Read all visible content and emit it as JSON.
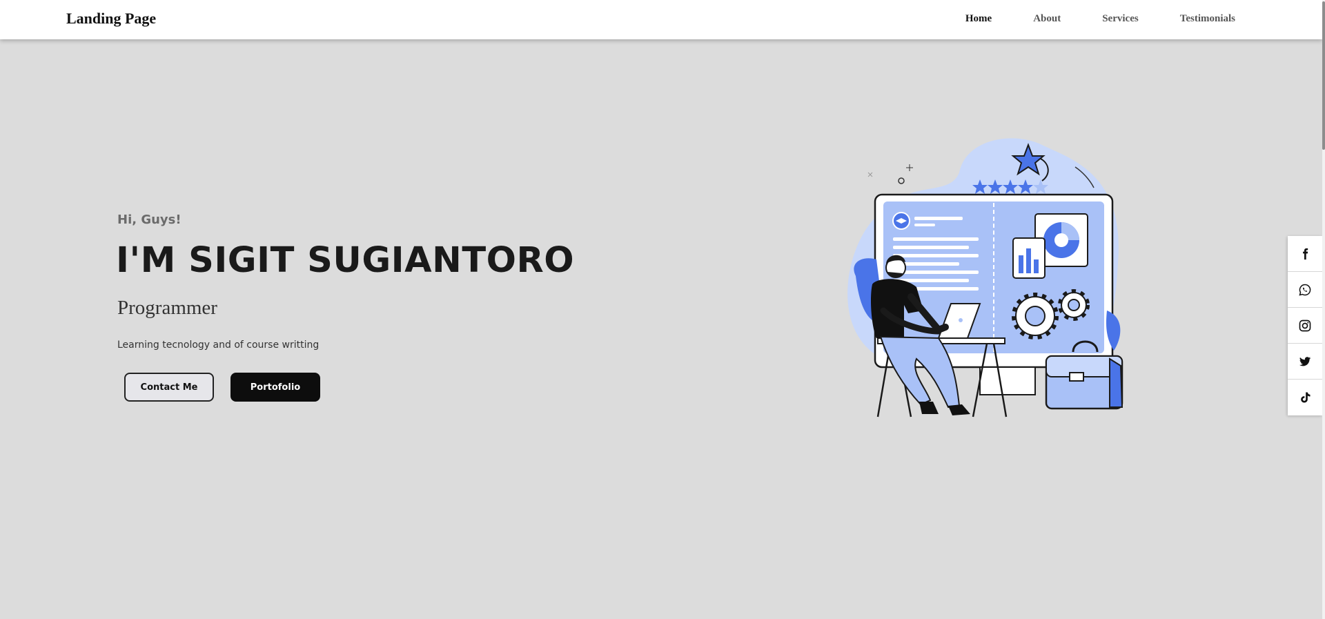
{
  "navbar": {
    "brand": "Landing Page",
    "links": [
      {
        "label": "Home",
        "active": true
      },
      {
        "label": "About",
        "active": false
      },
      {
        "label": "Services",
        "active": false
      },
      {
        "label": "Testimonials",
        "active": false
      }
    ]
  },
  "hero": {
    "greeting": "Hi, Guys!",
    "name": "I'M SIGIT SUGIANTORO",
    "role": "Programmer",
    "tagline": "Learning tecnology and of course writting",
    "contact_button": "Contact Me",
    "portfolio_button": "Portofolio"
  },
  "illustration": {
    "icon": "person-at-laptop-dashboard-illustration",
    "accent_color": "#4a74e8",
    "light_color": "#a9c1f7",
    "pale_color": "#c8d8fb"
  },
  "social": [
    {
      "icon": "facebook-icon"
    },
    {
      "icon": "whatsapp-icon"
    },
    {
      "icon": "instagram-icon"
    },
    {
      "icon": "twitter-icon"
    },
    {
      "icon": "tiktok-icon"
    }
  ],
  "colors": {
    "page_background": "#dcdcdc",
    "navbar_background": "#ffffff",
    "primary_text": "#1a1a1a",
    "portfolio_button_bg": "#0d0d0d",
    "contact_button_bg": "#e6e6ea"
  }
}
